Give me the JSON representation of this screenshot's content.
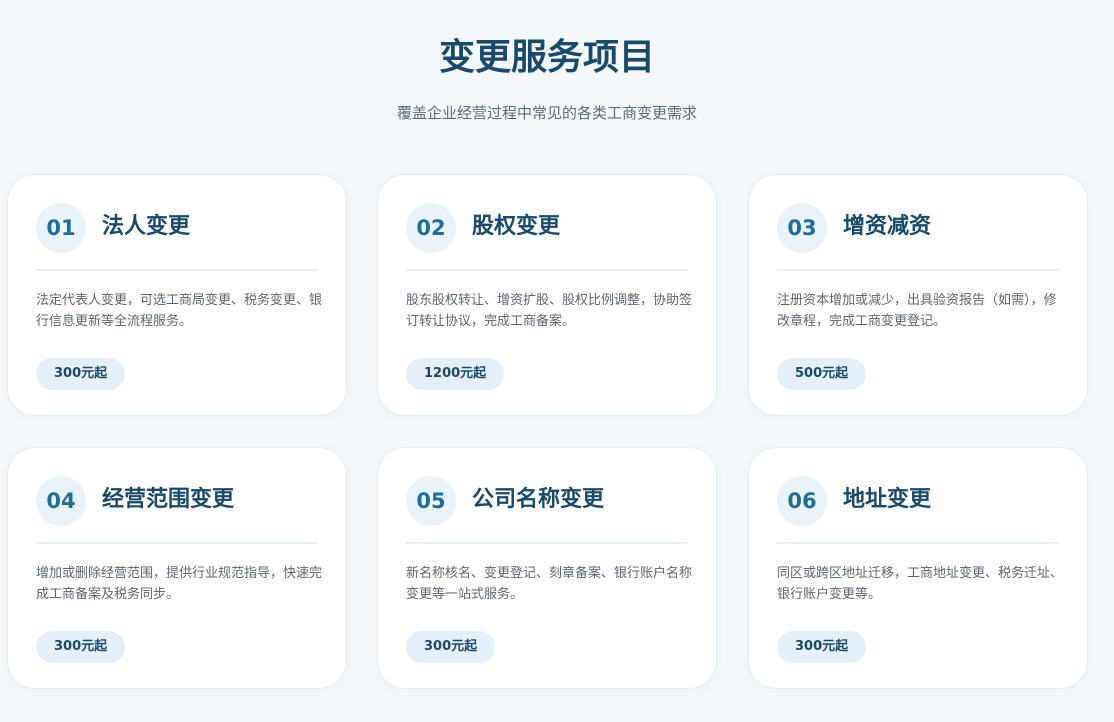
{
  "header": {
    "title": "变更服务项目",
    "subtitle": "覆盖企业经营过程中常见的各类工商变更需求"
  },
  "services": [
    {
      "number": "01",
      "title": "法人变更",
      "description": "法定代表人变更，可选工商局变更、税务变更、银行信息更新等全流程服务。",
      "price": "300元起"
    },
    {
      "number": "02",
      "title": "股权变更",
      "description": "股东股权转让、增资扩股、股权比例调整，协助签订转让协议，完成工商备案。",
      "price": "1200元起"
    },
    {
      "number": "03",
      "title": "增资减资",
      "description": "注册资本增加或减少，出具验资报告（如需），修改章程，完成工商变更登记。",
      "price": "500元起"
    },
    {
      "number": "04",
      "title": "经营范围变更",
      "description": "增加或删除经营范围，提供行业规范指导，快速完成工商备案及税务同步。",
      "price": "300元起"
    },
    {
      "number": "05",
      "title": "公司名称变更",
      "description": "新名称核名、变更登记、刻章备案、银行账户名称变更等一站式服务。",
      "price": "300元起"
    },
    {
      "number": "06",
      "title": "地址变更",
      "description": "同区或跨区地址迁移，工商地址变更、税务迁址、银行账户变更等。",
      "price": "300元起"
    }
  ]
}
